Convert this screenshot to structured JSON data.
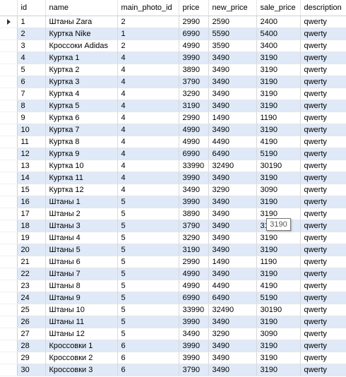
{
  "columns": [
    "id",
    "name",
    "main_photo_id",
    "price",
    "new_price",
    "sale_price",
    "description"
  ],
  "current_row_index": 0,
  "rows": [
    [
      "1",
      "Штаны Zara",
      "2",
      "2990",
      "2590",
      "2400",
      "qwerty"
    ],
    [
      "2",
      "Куртка Nike",
      "1",
      "6990",
      "5590",
      "5400",
      "qwerty"
    ],
    [
      "3",
      "Кроссоки Adidas",
      "2",
      "4990",
      "3590",
      "3400",
      "qwerty"
    ],
    [
      "4",
      "Куртка 1",
      "4",
      "3990",
      "3490",
      "3190",
      "qwerty"
    ],
    [
      "5",
      "Куртка 2",
      "4",
      "3890",
      "3490",
      "3190",
      "qwerty"
    ],
    [
      "6",
      "Куртка 3",
      "4",
      "3790",
      "3490",
      "3190",
      "qwerty"
    ],
    [
      "7",
      "Куртка 4",
      "4",
      "3290",
      "3490",
      "3190",
      "qwerty"
    ],
    [
      "8",
      "Куртка 5",
      "4",
      "3190",
      "3490",
      "3190",
      "qwerty"
    ],
    [
      "9",
      "Куртка 6",
      "4",
      "2990",
      "1490",
      "1190",
      "qwerty"
    ],
    [
      "10",
      "Куртка 7",
      "4",
      "4990",
      "3490",
      "3190",
      "qwerty"
    ],
    [
      "11",
      "Куртка 8",
      "4",
      "4990",
      "4490",
      "4190",
      "qwerty"
    ],
    [
      "12",
      "Куртка 9",
      "4",
      "6990",
      "6490",
      "5190",
      "qwerty"
    ],
    [
      "13",
      "Куртка 10",
      "4",
      "33990",
      "32490",
      "30190",
      "qwerty"
    ],
    [
      "14",
      "Куртка 11",
      "4",
      "3990",
      "3490",
      "3190",
      "qwerty"
    ],
    [
      "15",
      "Куртка 12",
      "4",
      "3490",
      "3290",
      "3090",
      "qwerty"
    ],
    [
      "16",
      "Штаны 1",
      "5",
      "3990",
      "3490",
      "3190",
      "qwerty"
    ],
    [
      "17",
      "Штаны 2",
      "5",
      "3890",
      "3490",
      "3190",
      "qwerty"
    ],
    [
      "18",
      "Штаны 3",
      "5",
      "3790",
      "3490",
      "3190",
      "qwerty"
    ],
    [
      "19",
      "Штаны 4",
      "5",
      "3290",
      "3490",
      "3190",
      "qwerty"
    ],
    [
      "20",
      "Штаны 5",
      "5",
      "3190",
      "3490",
      "3190",
      "qwerty"
    ],
    [
      "21",
      "Штаны 6",
      "5",
      "2990",
      "1490",
      "1190",
      "qwerty"
    ],
    [
      "22",
      "Штаны 7",
      "5",
      "4990",
      "3490",
      "3190",
      "qwerty"
    ],
    [
      "23",
      "Штаны 8",
      "5",
      "4990",
      "4490",
      "4190",
      "qwerty"
    ],
    [
      "24",
      "Штаны 9",
      "5",
      "6990",
      "6490",
      "5190",
      "qwerty"
    ],
    [
      "25",
      "Штаны 10",
      "5",
      "33990",
      "32490",
      "30190",
      "qwerty"
    ],
    [
      "26",
      "Штаны 11",
      "5",
      "3990",
      "3490",
      "3190",
      "qwerty"
    ],
    [
      "27",
      "Штаны 12",
      "5",
      "3490",
      "3290",
      "3090",
      "qwerty"
    ],
    [
      "28",
      "Кроссовки 1",
      "6",
      "3990",
      "3490",
      "3190",
      "qwerty"
    ],
    [
      "29",
      "Кроссовки 2",
      "6",
      "3990",
      "3490",
      "3190",
      "qwerty"
    ],
    [
      "30",
      "Кроссовки 3",
      "6",
      "3790",
      "3490",
      "3190",
      "qwerty"
    ]
  ],
  "tooltip": {
    "text": "3190"
  },
  "colors": {
    "alternate_row": "#dfe9f7",
    "grid_line": "#d8d8d8"
  },
  "icons": {
    "current_row_marker": "row-selector-arrow-icon"
  }
}
